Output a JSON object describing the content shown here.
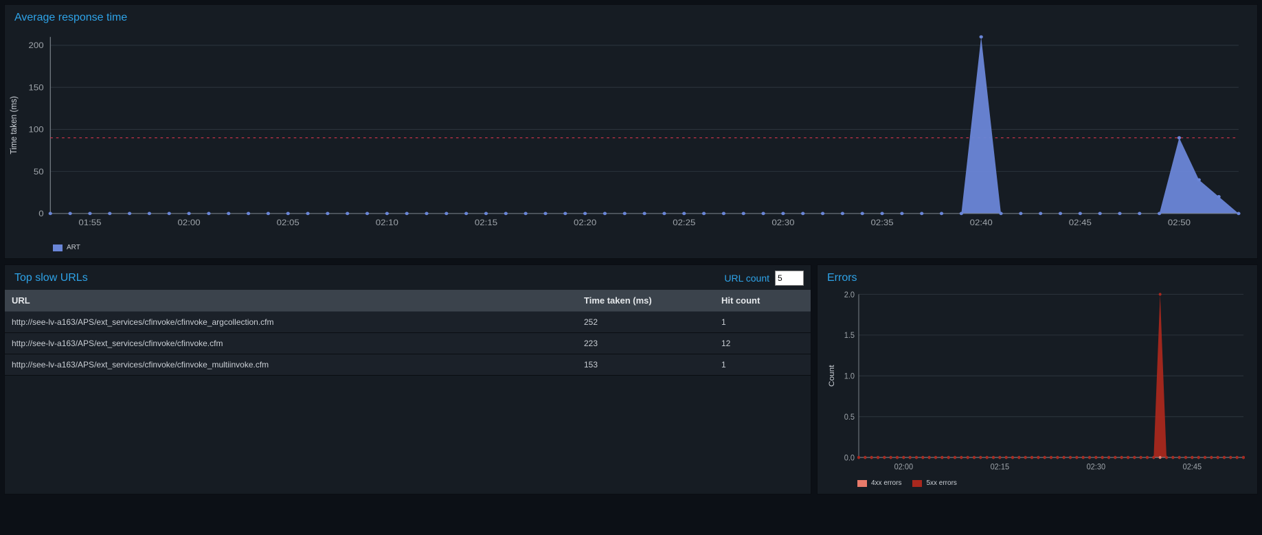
{
  "response_panel": {
    "title": "Average response time",
    "y_axis_title": "Time taken (ms)",
    "legend": "ART"
  },
  "slow_urls_panel": {
    "title": "Top slow URLs",
    "url_count_label": "URL count",
    "url_count_value": "5",
    "columns": {
      "url": "URL",
      "time": "Time taken (ms)",
      "hits": "Hit count"
    },
    "rows": [
      {
        "url": "http://see-lv-a163/APS/ext_services/cfinvoke/cfinvoke_argcollection.cfm",
        "time": "252",
        "hits": "1"
      },
      {
        "url": "http://see-lv-a163/APS/ext_services/cfinvoke/cfinvoke.cfm",
        "time": "223",
        "hits": "12"
      },
      {
        "url": "http://see-lv-a163/APS/ext_services/cfinvoke/cfinvoke_multiinvoke.cfm",
        "time": "153",
        "hits": "1"
      }
    ]
  },
  "errors_panel": {
    "title": "Errors",
    "y_axis_title": "Count",
    "legend4xx": "4xx errors",
    "legend5xx": "5xx errors"
  },
  "chart_data": [
    {
      "id": "avg_response_time",
      "type": "area",
      "title": "Average response time",
      "xlabel": "",
      "ylabel": "Time taken (ms)",
      "ylim": [
        0,
        210
      ],
      "y_ticks": [
        0,
        50,
        100,
        150,
        200
      ],
      "x_tick_labels": [
        "01:55",
        "02:00",
        "02:05",
        "02:10",
        "02:15",
        "02:20",
        "02:25",
        "02:30",
        "02:35",
        "02:40",
        "02:45",
        "02:50"
      ],
      "threshold": 90,
      "legend": [
        "ART"
      ],
      "series": [
        {
          "name": "ART",
          "x": [
            "01:53",
            "01:54",
            "01:55",
            "01:56",
            "01:57",
            "01:58",
            "01:59",
            "02:00",
            "02:01",
            "02:02",
            "02:03",
            "02:04",
            "02:05",
            "02:06",
            "02:07",
            "02:08",
            "02:09",
            "02:10",
            "02:11",
            "02:12",
            "02:13",
            "02:14",
            "02:15",
            "02:16",
            "02:17",
            "02:18",
            "02:19",
            "02:20",
            "02:21",
            "02:22",
            "02:23",
            "02:24",
            "02:25",
            "02:26",
            "02:27",
            "02:28",
            "02:29",
            "02:30",
            "02:31",
            "02:32",
            "02:33",
            "02:34",
            "02:35",
            "02:36",
            "02:37",
            "02:38",
            "02:39",
            "02:40",
            "02:41",
            "02:42",
            "02:43",
            "02:44",
            "02:45",
            "02:46",
            "02:47",
            "02:48",
            "02:49",
            "02:50",
            "02:51",
            "02:52",
            "02:53"
          ],
          "values": [
            0,
            0,
            0,
            0,
            0,
            0,
            0,
            0,
            0,
            0,
            0,
            0,
            0,
            0,
            0,
            0,
            0,
            0,
            0,
            0,
            0,
            0,
            0,
            0,
            0,
            0,
            0,
            0,
            0,
            0,
            0,
            0,
            0,
            0,
            0,
            0,
            0,
            0,
            0,
            0,
            0,
            0,
            0,
            0,
            0,
            0,
            0,
            210,
            0,
            0,
            0,
            0,
            0,
            0,
            0,
            0,
            0,
            90,
            40,
            20,
            0
          ]
        }
      ]
    },
    {
      "id": "errors",
      "type": "area",
      "title": "Errors",
      "xlabel": "",
      "ylabel": "Count",
      "ylim": [
        0,
        2.0
      ],
      "y_ticks": [
        0.0,
        0.5,
        1.0,
        1.5,
        2.0
      ],
      "x_tick_labels": [
        "02:00",
        "02:15",
        "02:30",
        "02:45"
      ],
      "legend": [
        "4xx errors",
        "5xx errors"
      ],
      "series": [
        {
          "name": "4xx errors",
          "x": [
            "01:53",
            "01:54",
            "01:55",
            "01:56",
            "01:57",
            "01:58",
            "01:59",
            "02:00",
            "02:01",
            "02:02",
            "02:03",
            "02:04",
            "02:05",
            "02:06",
            "02:07",
            "02:08",
            "02:09",
            "02:10",
            "02:11",
            "02:12",
            "02:13",
            "02:14",
            "02:15",
            "02:16",
            "02:17",
            "02:18",
            "02:19",
            "02:20",
            "02:21",
            "02:22",
            "02:23",
            "02:24",
            "02:25",
            "02:26",
            "02:27",
            "02:28",
            "02:29",
            "02:30",
            "02:31",
            "02:32",
            "02:33",
            "02:34",
            "02:35",
            "02:36",
            "02:37",
            "02:38",
            "02:39",
            "02:40",
            "02:41",
            "02:42",
            "02:43",
            "02:44",
            "02:45",
            "02:46",
            "02:47",
            "02:48",
            "02:49",
            "02:50",
            "02:51",
            "02:52",
            "02:53"
          ],
          "values": [
            0,
            0,
            0,
            0,
            0,
            0,
            0,
            0,
            0,
            0,
            0,
            0,
            0,
            0,
            0,
            0,
            0,
            0,
            0,
            0,
            0,
            0,
            0,
            0,
            0,
            0,
            0,
            0,
            0,
            0,
            0,
            0,
            0,
            0,
            0,
            0,
            0,
            0,
            0,
            0,
            0,
            0,
            0,
            0,
            0,
            0,
            0,
            0,
            0,
            0,
            0,
            0,
            0,
            0,
            0,
            0,
            0,
            0,
            0,
            0,
            0
          ]
        },
        {
          "name": "5xx errors",
          "x": [
            "01:53",
            "01:54",
            "01:55",
            "01:56",
            "01:57",
            "01:58",
            "01:59",
            "02:00",
            "02:01",
            "02:02",
            "02:03",
            "02:04",
            "02:05",
            "02:06",
            "02:07",
            "02:08",
            "02:09",
            "02:10",
            "02:11",
            "02:12",
            "02:13",
            "02:14",
            "02:15",
            "02:16",
            "02:17",
            "02:18",
            "02:19",
            "02:20",
            "02:21",
            "02:22",
            "02:23",
            "02:24",
            "02:25",
            "02:26",
            "02:27",
            "02:28",
            "02:29",
            "02:30",
            "02:31",
            "02:32",
            "02:33",
            "02:34",
            "02:35",
            "02:36",
            "02:37",
            "02:38",
            "02:39",
            "02:40",
            "02:41",
            "02:42",
            "02:43",
            "02:44",
            "02:45",
            "02:46",
            "02:47",
            "02:48",
            "02:49",
            "02:50",
            "02:51",
            "02:52",
            "02:53"
          ],
          "values": [
            0,
            0,
            0,
            0,
            0,
            0,
            0,
            0,
            0,
            0,
            0,
            0,
            0,
            0,
            0,
            0,
            0,
            0,
            0,
            0,
            0,
            0,
            0,
            0,
            0,
            0,
            0,
            0,
            0,
            0,
            0,
            0,
            0,
            0,
            0,
            0,
            0,
            0,
            0,
            0,
            0,
            0,
            0,
            0,
            0,
            0,
            0,
            2,
            0,
            0,
            0,
            0,
            0,
            0,
            0,
            0,
            0,
            0,
            0,
            0,
            0
          ]
        }
      ]
    }
  ]
}
